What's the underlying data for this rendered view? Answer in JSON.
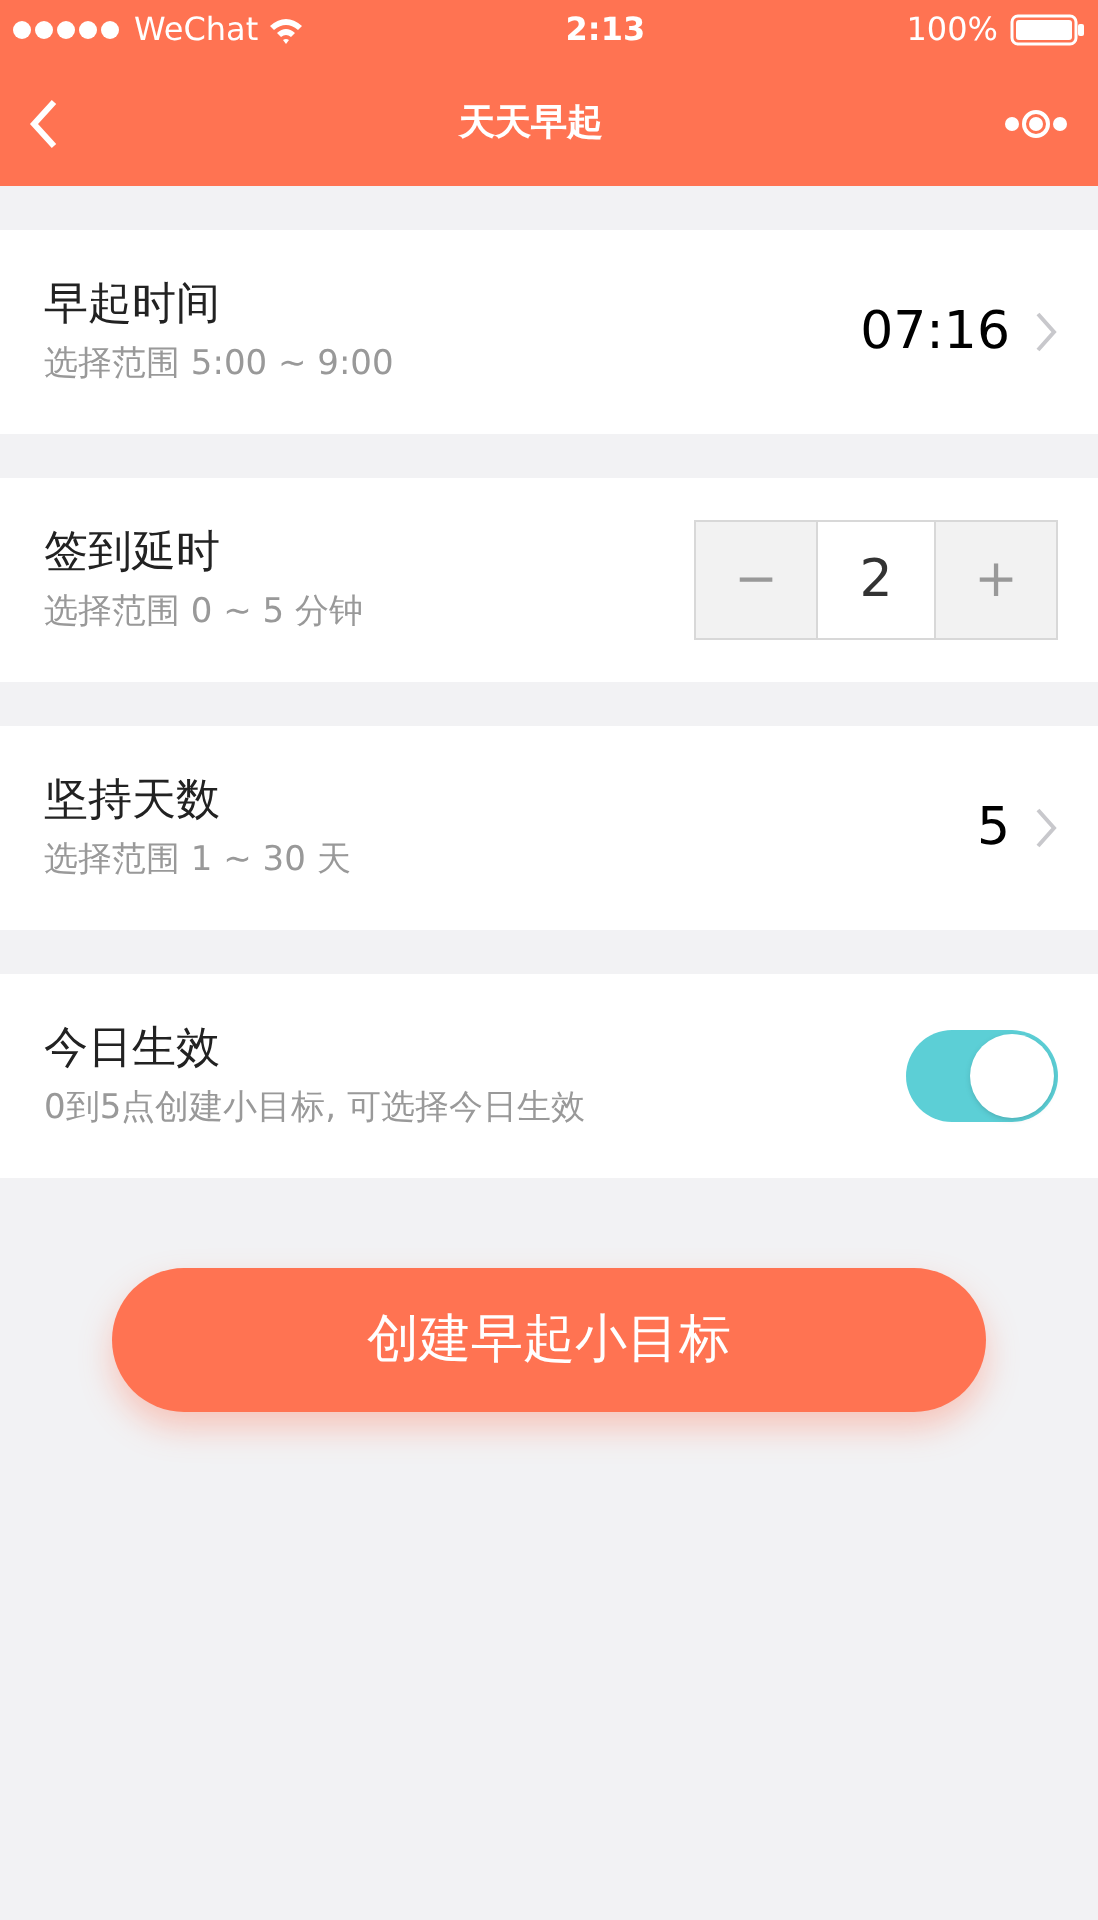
{
  "status_bar": {
    "carrier": "WeChat",
    "time": "2:13",
    "battery": "100%"
  },
  "nav": {
    "title": "天天早起"
  },
  "rows": [
    {
      "kind": "value",
      "title": "早起时间",
      "subtitle": "选择范围 5:00 ~ 9:00",
      "value": "07:16"
    },
    {
      "kind": "stepper",
      "title": "签到延时",
      "subtitle": "选择范围 0 ~ 5 分钟",
      "minus": "−",
      "value": "2",
      "plus": "+"
    },
    {
      "kind": "value",
      "title": "坚持天数",
      "subtitle": "选择范围 1 ~ 30 天",
      "value": "5"
    },
    {
      "kind": "switch",
      "title": "今日生效",
      "subtitle": "0到5点创建小目标, 可选择今日生效",
      "on": true
    }
  ],
  "button": "创建早起小目标"
}
